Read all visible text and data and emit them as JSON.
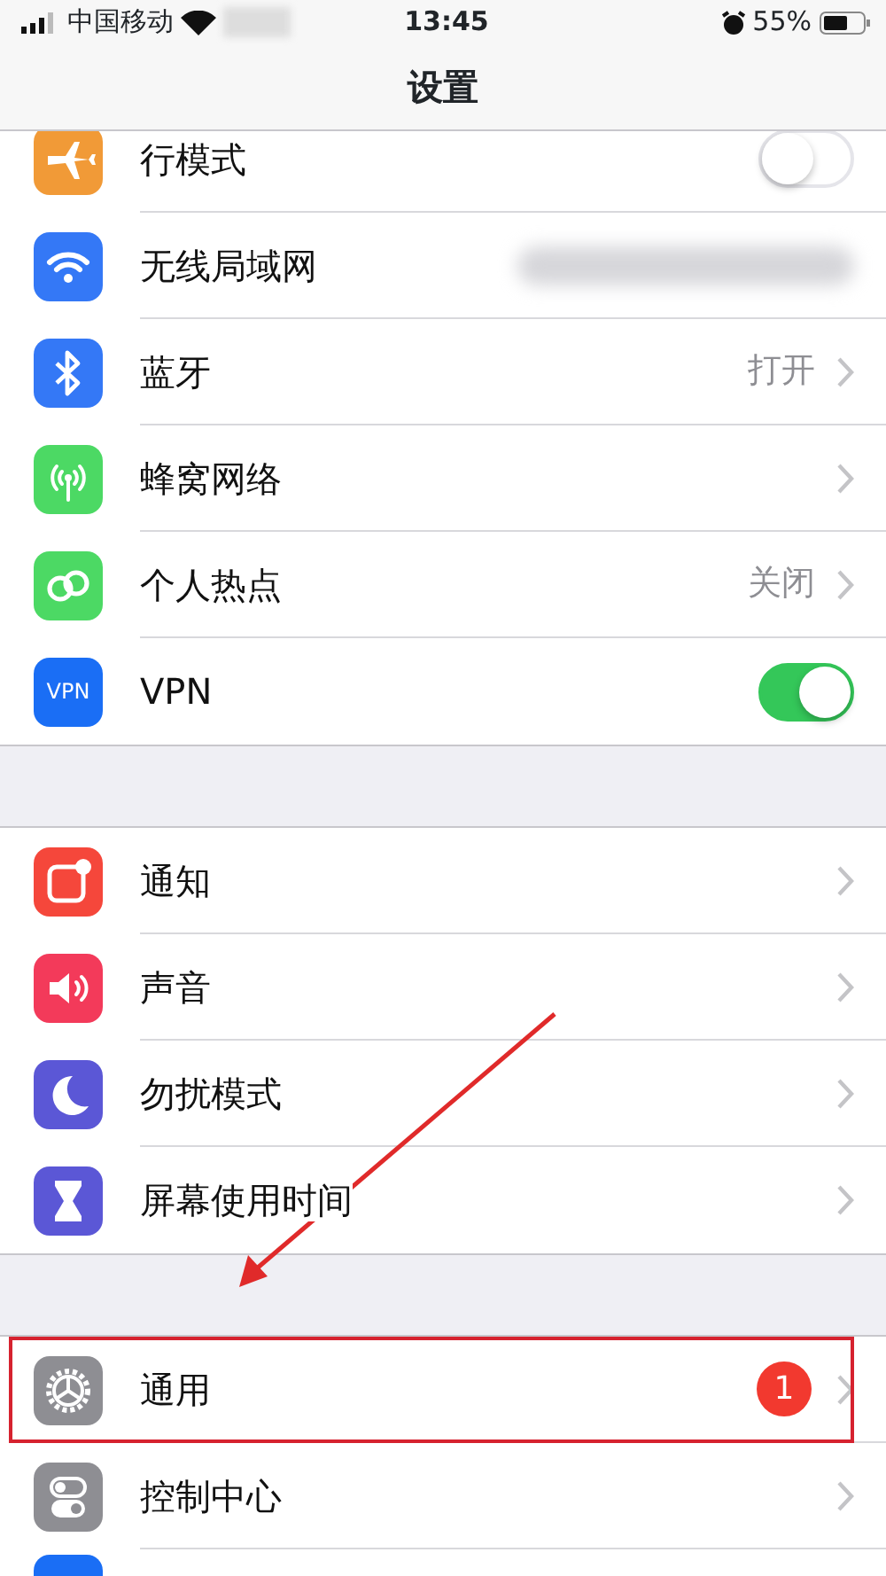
{
  "status_bar": {
    "carrier": "中国移动",
    "time": "13:45",
    "battery": "55%"
  },
  "title": "设置",
  "groups": [
    {
      "rows": [
        {
          "label": "行模式",
          "color": "#f19a37",
          "kind": "toggle",
          "on": false,
          "clipped": true
        },
        {
          "label": "无线局域网",
          "color": "#3478f6",
          "kind": "blurred"
        },
        {
          "label": "蓝牙",
          "color": "#3478f6",
          "kind": "chevron",
          "value": "打开"
        },
        {
          "label": "蜂窝网络",
          "color": "#4cd964",
          "kind": "chevron"
        },
        {
          "label": "个人热点",
          "color": "#4cd964",
          "kind": "chevron",
          "value": "关闭"
        },
        {
          "label": "VPN",
          "icon_text": "VPN",
          "color": "#1a6ef5",
          "kind": "toggle",
          "on": true
        }
      ]
    },
    {
      "rows": [
        {
          "label": "通知",
          "color": "#f5473b",
          "kind": "chevron"
        },
        {
          "label": "声音",
          "color": "#f33a5a",
          "kind": "chevron"
        },
        {
          "label": "勿扰模式",
          "color": "#5b57d6",
          "kind": "chevron"
        },
        {
          "label": "屏幕使用时间",
          "color": "#5b57d6",
          "kind": "chevron"
        }
      ]
    },
    {
      "rows": [
        {
          "label": "通用",
          "color": "#8e8e93",
          "kind": "chevron",
          "badge": "1",
          "highlighted": true
        },
        {
          "label": "控制中心",
          "color": "#8e8e93",
          "kind": "chevron"
        },
        {
          "color": "#1a6ef5",
          "kind": "peek"
        }
      ]
    }
  ]
}
